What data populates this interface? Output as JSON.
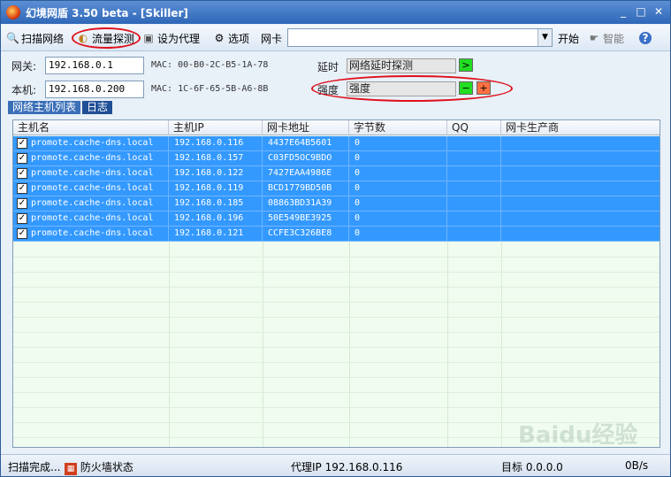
{
  "window": {
    "title": "幻境网盾  3.50 beta - [Skiller]",
    "controls": [
      "_",
      "□",
      "✕"
    ]
  },
  "toolbar": {
    "scan_label": "扫描网络",
    "traffic_label": "流量探测",
    "proxy_label": "设为代理",
    "options_label": "选项",
    "nic_label": "网卡",
    "nic_value": "",
    "start_label": "开始",
    "smart_label": "智能"
  },
  "info": {
    "gateway_label": "网关:",
    "gateway_ip": "192.168.0.1",
    "gateway_mac": "MAC: 00-B0-2C-B5-1A-78",
    "local_label": "本机:",
    "local_ip": "192.168.0.200",
    "local_mac": "MAC: 1C-6F-65-5B-A6-8B",
    "delay_label": "延时",
    "delay_value": "网络延时探测",
    "delay_btn": ">",
    "strength_label": "强度",
    "strength_value": "强度",
    "minus_btn": "−",
    "plus_btn": "+"
  },
  "tabs": [
    "网络主机列表",
    "日志"
  ],
  "table": {
    "columns": [
      "主机名",
      "主机IP",
      "网卡地址",
      "字节数",
      "QQ",
      "网卡生产商"
    ],
    "rows": [
      [
        "promote.cache-dns.local",
        "192.168.0.116",
        "4437E64B5601",
        "0",
        "",
        ""
      ],
      [
        "promote.cache-dns.local",
        "192.168.0.157",
        "C03FD5OC9BDO",
        "0",
        "",
        ""
      ],
      [
        "promote.cache-dns.local",
        "192.168.0.122",
        "7427EAA4986E",
        "0",
        "",
        ""
      ],
      [
        "promote.cache-dns.local",
        "192.168.0.119",
        "BCD1779BD50B",
        "0",
        "",
        ""
      ],
      [
        "promote.cache-dns.local",
        "192.168.0.185",
        "08863BD31A39",
        "0",
        "",
        ""
      ],
      [
        "promote.cache-dns.local",
        "192.168.0.196",
        "50E549BE3925",
        "0",
        "",
        ""
      ],
      [
        "promote.cache-dns.local",
        "192.168.0.121",
        "CCFE3C326BE8",
        "0",
        "",
        ""
      ]
    ]
  },
  "status": {
    "scan_status": "扫描完成...",
    "firewall_label": "防火墙状态",
    "proxy_ip": "代理IP 192.168.0.116",
    "target": "目标 0.0.0.0",
    "speed": "0B/s"
  },
  "watermark": "Baidu经验",
  "colors": {
    "row_selected": "#3399ff",
    "table_bg": "#f0fcf0",
    "highlight_oval": "#e0101a",
    "green_btn": "#22dd22",
    "orange_btn": "#ff7040"
  }
}
